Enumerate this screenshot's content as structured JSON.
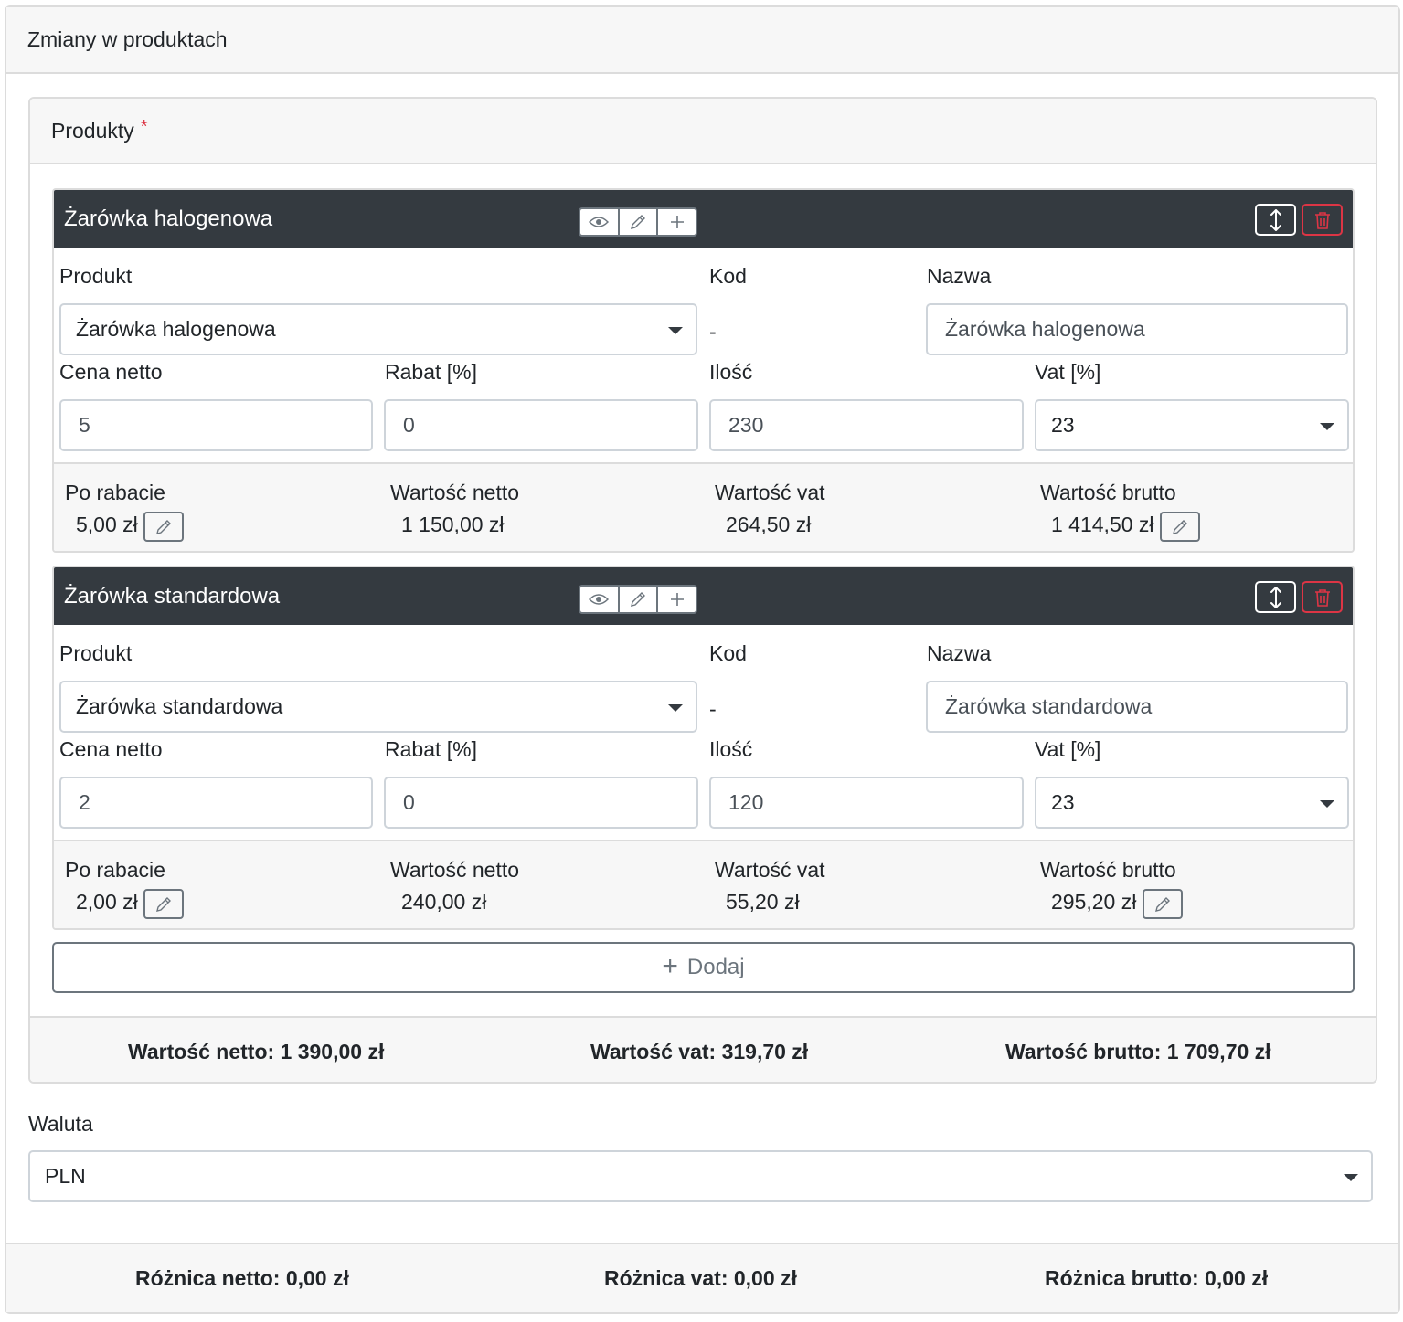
{
  "outer_card": {
    "title": "Zmiany w produktach"
  },
  "products": {
    "title": "Produkty",
    "required_mark": "*",
    "labels": {
      "produkt": "Produkt",
      "kod": "Kod",
      "nazwa": "Nazwa",
      "cena_netto": "Cena netto",
      "rabat": "Rabat [%]",
      "ilosc": "Ilość",
      "vat": "Vat [%]",
      "po_rabacie": "Po rabacie",
      "wartosc_netto": "Wartość netto",
      "wartosc_vat": "Wartość vat",
      "wartosc_brutto": "Wartość brutto"
    },
    "items": [
      {
        "title": "Żarówka halogenowa",
        "produkt_selected": "Żarówka halogenowa",
        "kod": "-",
        "nazwa": "Żarówka halogenowa",
        "cena_netto": "5",
        "rabat": "0",
        "ilosc": "230",
        "vat": "23",
        "po_rabacie": "5,00 zł",
        "wartosc_netto": "1 150,00 zł",
        "wartosc_vat": "264,50 zł",
        "wartosc_brutto": "1 414,50 zł"
      },
      {
        "title": "Żarówka standardowa",
        "produkt_selected": "Żarówka standardowa",
        "kod": "-",
        "nazwa": "Żarówka standardowa",
        "cena_netto": "2",
        "rabat": "0",
        "ilosc": "120",
        "vat": "23",
        "po_rabacie": "2,00 zł",
        "wartosc_netto": "240,00 zł",
        "wartosc_vat": "55,20 zł",
        "wartosc_brutto": "295,20 zł"
      }
    ],
    "add_label": "Dodaj",
    "add_icon": "+",
    "totals": {
      "netto": "Wartość netto: 1 390,00 zł",
      "vat": "Wartość vat: 319,70 zł",
      "brutto": "Wartość brutto: 1 709,70 zł"
    }
  },
  "waluta": {
    "label": "Waluta",
    "selected": "PLN"
  },
  "footer": {
    "netto": "Różnica netto: 0,00 zł",
    "vat": "Różnica vat: 0,00 zł",
    "brutto": "Różnica brutto: 0,00 zł"
  },
  "colors": {
    "header_dark": "#343a40",
    "danger": "#dc3545",
    "secondary": "#6c757d",
    "panel_bg": "#f7f7f7"
  },
  "icons": [
    "move-vertical-icon",
    "trash-icon",
    "eye-icon",
    "pencil-icon",
    "plus-icon",
    "chevron-down-icon"
  ]
}
